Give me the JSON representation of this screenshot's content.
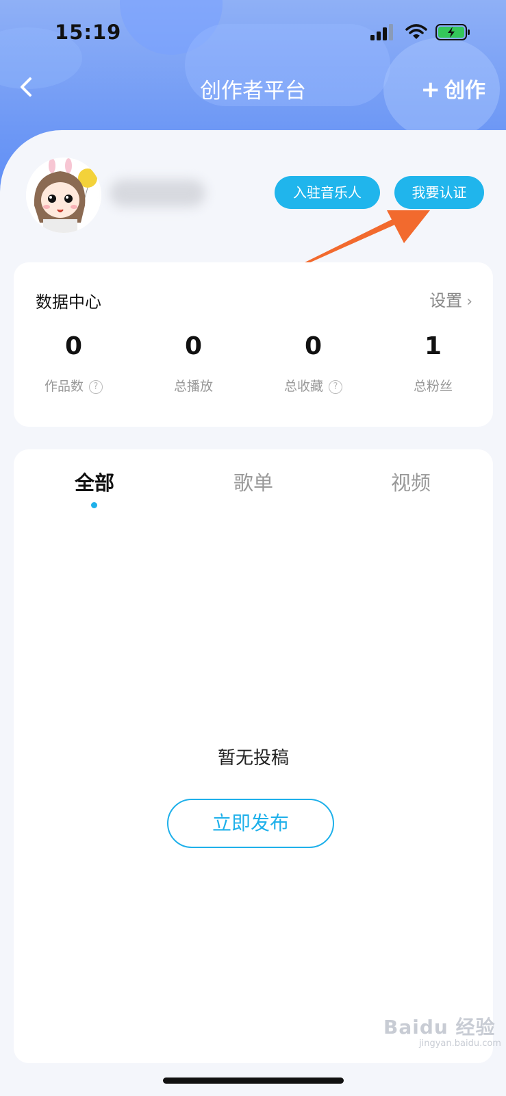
{
  "status_bar": {
    "time": "15:19"
  },
  "header": {
    "title": "创作者平台",
    "create_label": "创作"
  },
  "profile": {
    "musician_button": "入驻音乐人",
    "certify_button": "我要认证"
  },
  "data_center": {
    "title": "数据中心",
    "settings_label": "设置",
    "stats": [
      {
        "value": "0",
        "label": "作品数"
      },
      {
        "value": "0",
        "label": "总播放"
      },
      {
        "value": "0",
        "label": "总收藏"
      },
      {
        "value": "1",
        "label": "总粉丝"
      }
    ]
  },
  "content": {
    "tabs": [
      "全部",
      "歌单",
      "视频"
    ],
    "empty_text": "暂无投稿",
    "publish_button": "立即发布"
  },
  "watermark": {
    "logo_text": "Baidu 经验",
    "site": "jingyan.baidu.com"
  },
  "colors": {
    "accent": "#1eb0ea",
    "header_blue": "#6f99f5",
    "arrow": "#f26a2e"
  }
}
